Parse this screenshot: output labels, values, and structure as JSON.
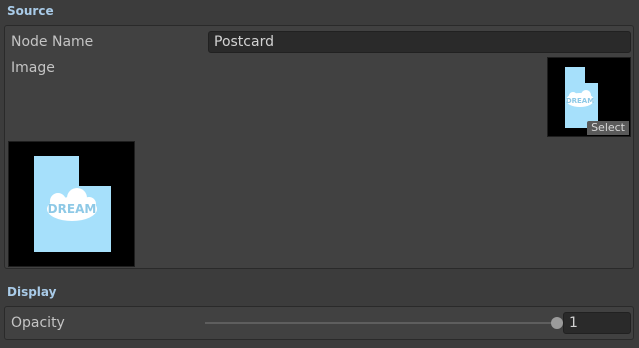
{
  "source": {
    "header": "Source",
    "node_name_label": "Node Name",
    "node_name_value": "Postcard",
    "image_label": "Image",
    "select_label": "Select",
    "thumbnail_text": "DREAM"
  },
  "display": {
    "header": "Display",
    "opacity_label": "Opacity",
    "opacity_value": "1",
    "opacity_fraction": 1.0
  },
  "colors": {
    "header_text": "#a9cbe8",
    "card_blue": "#a6e0fb",
    "bubble_text": "#8ec9e6"
  }
}
